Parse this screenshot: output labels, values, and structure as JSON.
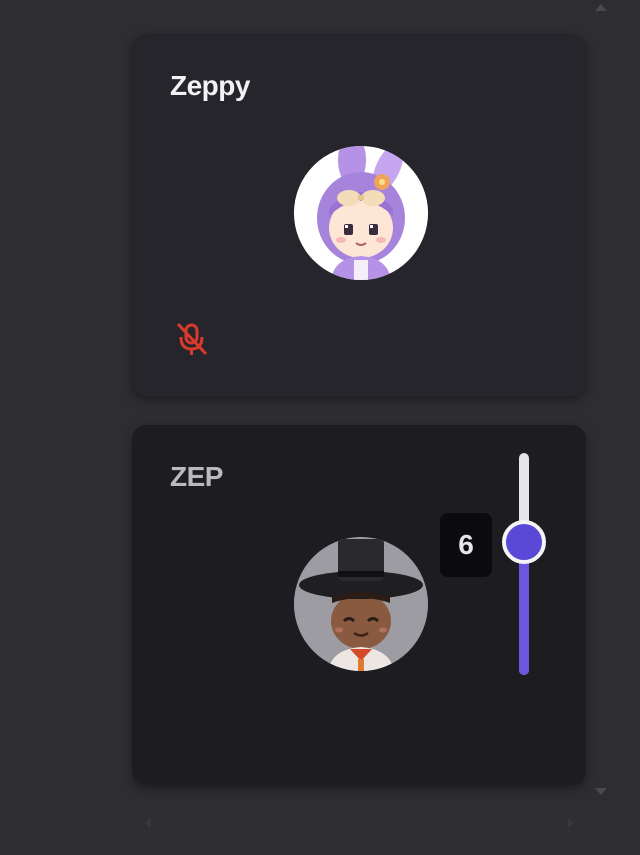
{
  "participants": [
    {
      "name": "Zeppy",
      "avatar_icon": "bunny-hood-character-avatar-icon",
      "muted": true,
      "mute_icon": "microphone-off-icon",
      "mute_color": "#d93a2b"
    },
    {
      "name": "ZEP",
      "avatar_icon": "gat-hat-character-avatar-icon",
      "volume": {
        "value": "6",
        "level": 0.6
      },
      "accent_color": "#6b56e0"
    }
  ]
}
